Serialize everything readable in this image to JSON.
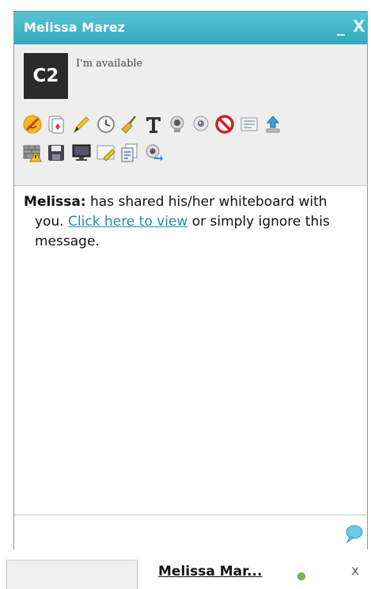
{
  "window": {
    "title": "Melissa Marez",
    "minimize_label": "_",
    "close_label": "X"
  },
  "profile": {
    "avatar_text": "C2",
    "status": "I'm available"
  },
  "toolbar": {
    "row1": [
      "smiley-icon",
      "card-game-icon",
      "pencil-icon",
      "clock-icon",
      "broom-icon",
      "text-format-icon",
      "webcam-icon",
      "webcam-round-icon",
      "block-icon",
      "list-icon",
      "upload-icon"
    ],
    "row2": [
      "warning-wall-icon",
      "save-icon",
      "monitor-icon",
      "whiteboard-icon",
      "copy-icon",
      "webcam-share-icon"
    ]
  },
  "messages": [
    {
      "sender": "Melissa:",
      "text_before": " has shared his/her whiteboard with you. ",
      "link": "Click here to view",
      "text_after": " or simply ignore this message."
    }
  ],
  "taskbar": {
    "tab_label": "Melissa Mar...",
    "close_label": "x"
  },
  "colors": {
    "titlebar": "#3fb6c8",
    "link": "#1f8fa8",
    "online": "#6cc04a"
  }
}
